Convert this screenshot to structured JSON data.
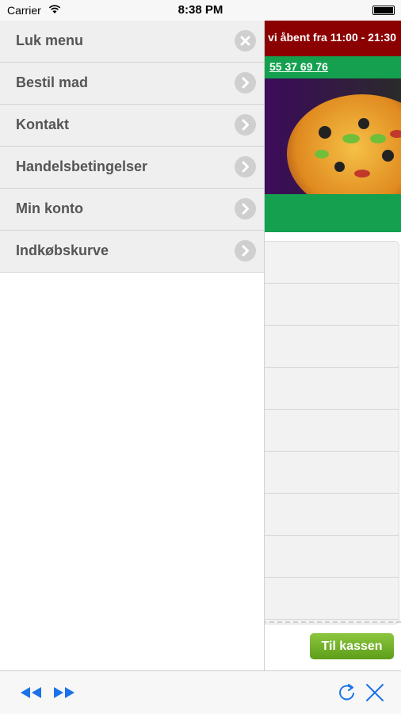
{
  "status_bar": {
    "carrier": "Carrier",
    "time": "8:38 PM"
  },
  "site": {
    "hours_text": "vi åbent fra 11:00 - 21:30",
    "phone_text": "55 37 69 76",
    "checkout_button": "Til kassen",
    "colors": {
      "header_red": "#8b0000",
      "green": "#14a04f",
      "checkout_green": "#6aae24"
    }
  },
  "menu": {
    "items": [
      {
        "label": "Luk menu",
        "icon": "close-icon"
      },
      {
        "label": "Bestil mad",
        "icon": "chevron-right-icon"
      },
      {
        "label": "Kontakt",
        "icon": "chevron-right-icon"
      },
      {
        "label": "Handelsbetingelser",
        "icon": "chevron-right-icon"
      },
      {
        "label": "Min konto",
        "icon": "chevron-right-icon"
      },
      {
        "label": "Indkøbskurve",
        "icon": "chevron-right-icon"
      }
    ]
  },
  "toolbar": {
    "icons": [
      "rewind-icon",
      "fast-forward-icon",
      "refresh-icon",
      "close-icon"
    ],
    "accent": "#1a73e8"
  }
}
